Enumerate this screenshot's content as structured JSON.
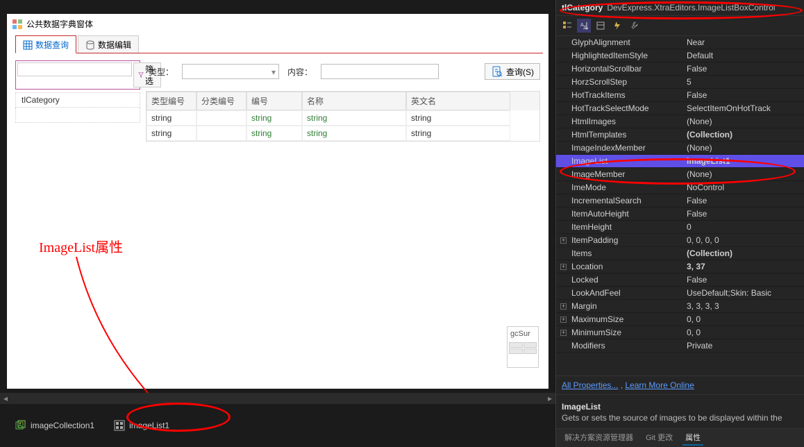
{
  "form": {
    "title": "公共数据字典窗体",
    "tabs": {
      "query": "数据查询",
      "edit": "数据编辑"
    },
    "left_list": {
      "filter_btn": "筛选",
      "item0": "tlCategory"
    },
    "search": {
      "type_label": "类型：",
      "content_label": "内容：",
      "query_btn": "查询(S)"
    },
    "grid": {
      "h0": "类型编号",
      "h1": "分类编号",
      "h2": "编号",
      "h3": "名称",
      "h4": "英文名",
      "rows": [
        {
          "c0": "string",
          "c2": "string",
          "c3": "string",
          "c4": "string"
        },
        {
          "c0": "string",
          "c2": "string",
          "c3": "string",
          "c4": "string"
        }
      ]
    },
    "gcsum": "gcSur"
  },
  "tray": {
    "item0": "imageCollection1",
    "item1": "imageList1"
  },
  "annotation": {
    "label": "ImageList属性"
  },
  "props": {
    "selected_name": "tlCategory",
    "selected_type": "DevExpress.XtraEditors.ImageListBoxControl",
    "rows": [
      {
        "n": "GlyphAlignment",
        "v": "Near"
      },
      {
        "n": "HighlightedItemStyle",
        "v": "Default"
      },
      {
        "n": "HorizontalScrollbar",
        "v": "False"
      },
      {
        "n": "HorzScrollStep",
        "v": "5"
      },
      {
        "n": "HotTrackItems",
        "v": "False"
      },
      {
        "n": "HotTrackSelectMode",
        "v": "SelectItemOnHotTrack"
      },
      {
        "n": "HtmlImages",
        "v": "(None)"
      },
      {
        "n": "HtmlTemplates",
        "v": "(Collection)",
        "bold": true
      },
      {
        "n": "ImageIndexMember",
        "v": "(None)"
      },
      {
        "n": "ImageList",
        "v": "imageList1",
        "bold": true,
        "selected": true
      },
      {
        "n": "ImageMember",
        "v": "(None)"
      },
      {
        "n": "ImeMode",
        "v": "NoControl"
      },
      {
        "n": "IncrementalSearch",
        "v": "False"
      },
      {
        "n": "ItemAutoHeight",
        "v": "False"
      },
      {
        "n": "ItemHeight",
        "v": "0"
      },
      {
        "n": "ItemPadding",
        "v": "0, 0, 0, 0",
        "expand": true
      },
      {
        "n": "Items",
        "v": "(Collection)",
        "bold": true
      },
      {
        "n": "Location",
        "v": "3, 37",
        "expand": true,
        "bold": true
      },
      {
        "n": "Locked",
        "v": "False"
      },
      {
        "n": "LookAndFeel",
        "v": "UseDefault;Skin: Basic"
      },
      {
        "n": "Margin",
        "v": "3, 3, 3, 3",
        "expand": true
      },
      {
        "n": "MaximumSize",
        "v": "0, 0",
        "expand": true
      },
      {
        "n": "MinimumSize",
        "v": "0, 0",
        "expand": true
      },
      {
        "n": "Modifiers",
        "v": "Private"
      }
    ],
    "links": {
      "all": "All Properties...",
      "more": "Learn More Online"
    },
    "desc": {
      "title": "ImageList",
      "text": "Gets or sets the source of images to be displayed within the"
    },
    "bottom_tabs": {
      "t0": "解决方案资源管理器",
      "t1": "Git 更改",
      "t2": "属性"
    }
  }
}
